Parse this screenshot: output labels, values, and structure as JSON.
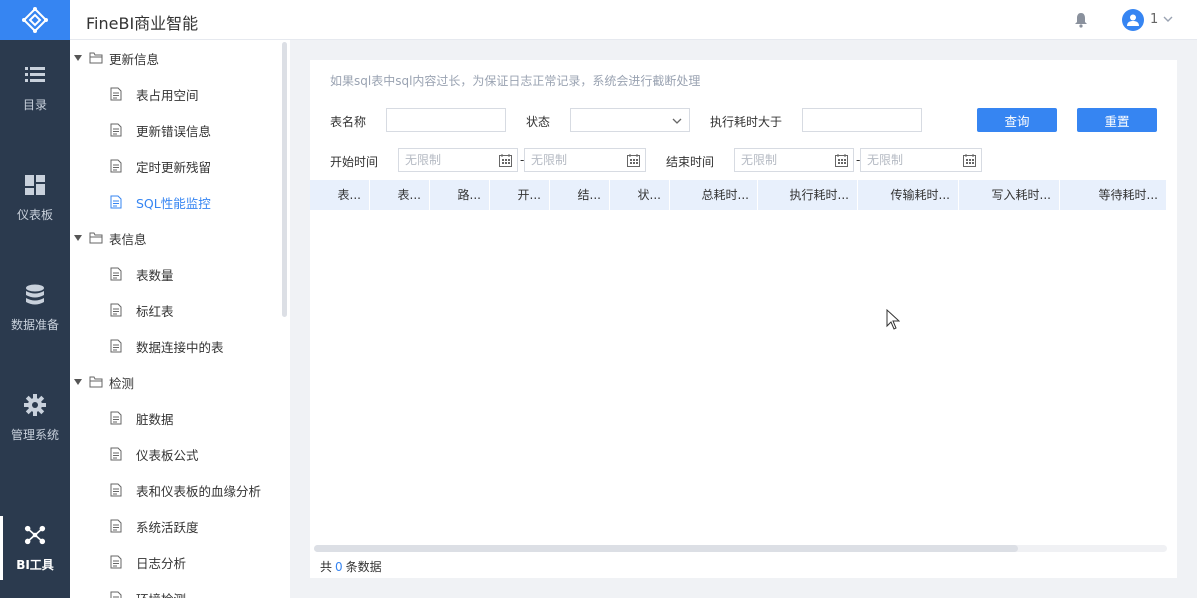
{
  "app": {
    "title": "FineBI商业智能"
  },
  "header": {
    "user_name": "1",
    "icons": [
      "bell-icon",
      "user-avatar-icon",
      "chevron-down-icon"
    ]
  },
  "rail": {
    "items": [
      {
        "label": "目录",
        "icon": "list-icon"
      },
      {
        "label": "仪表板",
        "icon": "dashboard-icon"
      },
      {
        "label": "数据准备",
        "icon": "database-icon"
      },
      {
        "label": "管理系统",
        "icon": "gear-icon"
      },
      {
        "label": "BI工具",
        "icon": "network-icon",
        "active": true
      }
    ]
  },
  "tree": {
    "groups": [
      {
        "label": "更新信息",
        "items": [
          "表占用空间",
          "更新错误信息",
          "定时更新残留",
          "SQL性能监控"
        ]
      },
      {
        "label": "表信息",
        "items": [
          "表数量",
          "标红表",
          "数据连接中的表"
        ]
      },
      {
        "label": "检测",
        "items": [
          "脏数据",
          "仪表板公式",
          "表和仪表板的血缘分析",
          "系统活跃度",
          "日志分析",
          "环境检测"
        ]
      }
    ],
    "selected": "SQL性能监控"
  },
  "main": {
    "hint": "如果sql表中sql内容过长，为保证日志正常记录，系统会进行截断处理",
    "filters": {
      "table_name_label": "表名称",
      "status_label": "状态",
      "exec_time_label": "执行耗时大于",
      "start_time_label": "开始时间",
      "end_time_label": "结束时间",
      "date_placeholder": "无限制",
      "range_sep": "-"
    },
    "buttons": {
      "query": "查询",
      "reset": "重置"
    },
    "columns": [
      "表...",
      "表...",
      "路...",
      "开...",
      "结...",
      "状...",
      "总耗时...",
      "执行耗时...",
      "传输耗时...",
      "写入耗时...",
      "等待耗时..."
    ],
    "footer": {
      "prefix": "共",
      "count": "0",
      "suffix": "条数据"
    }
  },
  "colors": {
    "accent": "#3685f2",
    "rail_bg": "#2b3a4e",
    "table_header_bg": "#e8f0fc"
  }
}
